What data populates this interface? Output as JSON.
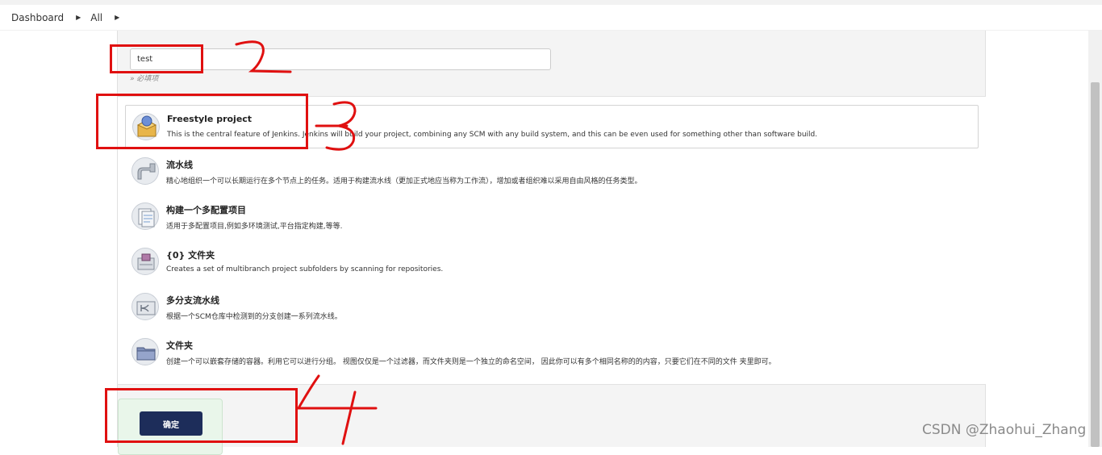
{
  "breadcrumb": {
    "items": [
      {
        "label": "Dashboard"
      },
      {
        "label": "All"
      }
    ]
  },
  "form": {
    "item_name_value": "test",
    "required_hint": "» 必填项"
  },
  "project_types": [
    {
      "title": "Freestyle project",
      "description": "This is the central feature of Jenkins. Jenkins will build your project, combining any SCM with any build system, and this can be even used for something other than software build.",
      "icon": "freestyle-package-icon",
      "selected": true
    },
    {
      "title": "流水线",
      "description": "精心地组织一个可以长期运行在多个节点上的任务。适用于构建流水线（更加正式地应当称为工作流），增加或者组织难以采用自由风格的任务类型。",
      "icon": "pipeline-icon"
    },
    {
      "title": "构建一个多配置项目",
      "description": "适用于多配置项目,例如多环境测试,平台指定构建,等等.",
      "icon": "multi-config-icon"
    },
    {
      "title": "{0} 文件夹",
      "description": "Creates a set of multibranch project subfolders by scanning for repositories.",
      "icon": "org-folder-icon"
    },
    {
      "title": "多分支流水线",
      "description": "根据一个SCM仓库中检测到的分支创建一系列流水线。",
      "icon": "multibranch-pipeline-icon"
    },
    {
      "title": "文件夹",
      "description": "创建一个可以嵌套存储的容器。利用它可以进行分组。 视图仅仅是一个过滤器，而文件夹则是一个独立的命名空间， 因此你可以有多个相同名称的的内容，只要它们在不同的文件 夹里即可。",
      "icon": "folder-icon"
    }
  ],
  "actions": {
    "ok_label": "确定"
  },
  "watermark": "CSDN @Zhaohui_Zhang",
  "colors": {
    "annotation_red": "#e01010",
    "ok_button": "#1d2d5a",
    "ok_box": "#e9f6ea"
  }
}
